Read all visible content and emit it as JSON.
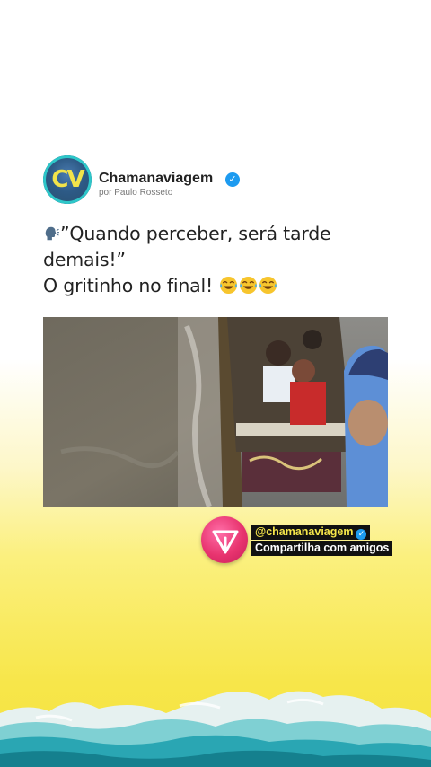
{
  "post": {
    "account_name": "Chamanaviagem",
    "byline": "por Paulo Rosseto",
    "avatar_monogram": "CV",
    "text_line1": "”Quando perceber, será tarde",
    "text_line2": "demais!”",
    "text_line3": "O gritinho no final!",
    "icons": {
      "lead": "speaking-head-icon",
      "verified": "verified-badge-icon",
      "trailing": [
        "laughing-tears-emoji",
        "laughing-tears-emoji",
        "laughing-tears-emoji"
      ]
    },
    "media_description_icon": "video-thumbnail"
  },
  "share": {
    "handle": "@chamanaviagem",
    "cta": "Compartilha com amigos",
    "icon": "share-arrow-icon"
  },
  "colors": {
    "background_top": "#ffffff",
    "background_bottom": "#f5e23e",
    "verified": "#1d9bf0",
    "accent_pink": "#e8346f",
    "sea": "#2aa6b3"
  }
}
